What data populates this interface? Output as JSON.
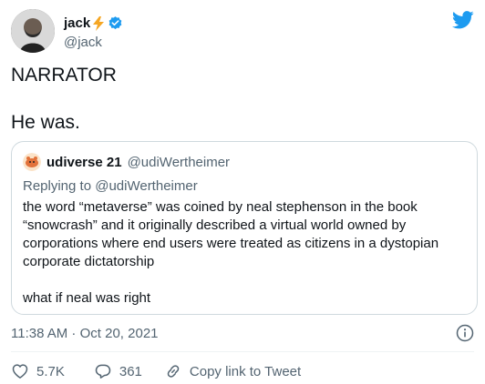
{
  "author": {
    "display_name": "jack",
    "handle": "@jack"
  },
  "tweet": {
    "text": "NARRATOR\n\nHe was."
  },
  "quote": {
    "display_name": "udiverse 21",
    "handle": "@udiWertheimer",
    "reply_prefix": "Replying to ",
    "reply_handle": "@udiWertheimer",
    "paragraph_1": "the word “metaverse” was coined by neal stephenson in the book “snowcrash” and it originally described a virtual world owned by corporations where end users were treated as citizens in a dystopian corporate dictatorship",
    "paragraph_2": "what if neal was right"
  },
  "meta": {
    "time": "11:38 AM",
    "separator": " · ",
    "date": "Oct 20, 2021"
  },
  "actions": {
    "likes": "5.7K",
    "replies": "361",
    "copy_link": "Copy link to Tweet"
  },
  "colors": {
    "twitter_blue": "#1d9bf0",
    "text_primary": "#0f1419",
    "text_secondary": "#536471",
    "border": "#cfd9de",
    "bolt": "#f5a623"
  },
  "icons": [
    "lightning-bolt-icon",
    "verified-badge-icon",
    "twitter-bird-icon",
    "info-icon",
    "heart-icon",
    "reply-icon",
    "link-icon"
  ]
}
